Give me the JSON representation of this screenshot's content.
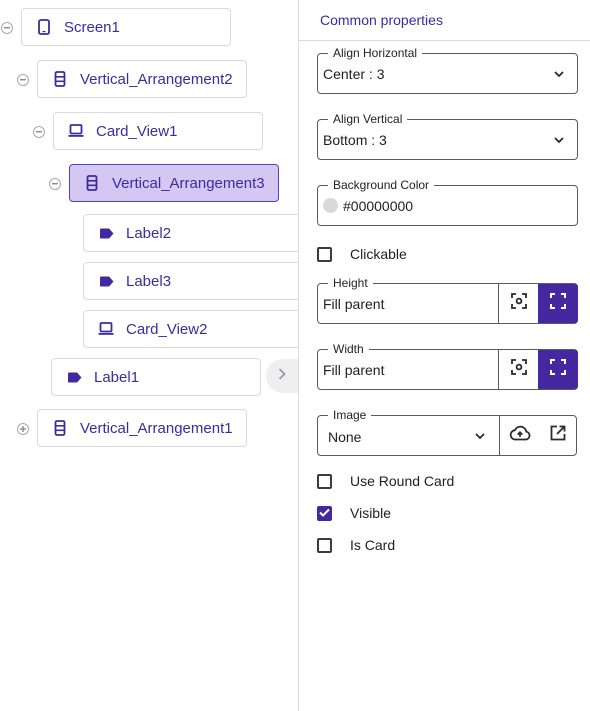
{
  "tree": {
    "nodes": [
      {
        "label": "Screen1",
        "icon": "phone-icon",
        "toggle": "collapse"
      },
      {
        "label": "Vertical_Arrangement2",
        "icon": "vertical-arrangement-icon",
        "toggle": "collapse"
      },
      {
        "label": "Card_View1",
        "icon": "card-view-icon",
        "toggle": "collapse"
      },
      {
        "label": "Vertical_Arrangement3",
        "icon": "vertical-arrangement-icon",
        "toggle": "collapse",
        "selected": true
      },
      {
        "label": "Label2",
        "icon": "label-tag-icon"
      },
      {
        "label": "Label3",
        "icon": "label-tag-icon"
      },
      {
        "label": "Card_View2",
        "icon": "card-view-icon"
      },
      {
        "label": "Label1",
        "icon": "label-tag-icon"
      },
      {
        "label": "Vertical_Arrangement1",
        "icon": "vertical-arrangement-icon",
        "toggle": "expand"
      }
    ],
    "collapse_tab_icon": "chevron-right-icon"
  },
  "properties": {
    "title": "Common properties",
    "align_horizontal": {
      "label": "Align Horizontal",
      "value": "Center : 3"
    },
    "align_vertical": {
      "label": "Align Vertical",
      "value": "Bottom : 3"
    },
    "background_color": {
      "label": "Background Color",
      "value": "#00000000",
      "swatch_color": "#d9d9d9"
    },
    "clickable": {
      "label": "Clickable",
      "checked": false
    },
    "height": {
      "label": "Height",
      "value": "Fill parent"
    },
    "width": {
      "label": "Width",
      "value": "Fill parent"
    },
    "image": {
      "label": "Image",
      "value": "None"
    },
    "use_round_card": {
      "label": "Use Round Card",
      "checked": false
    },
    "visible": {
      "label": "Visible",
      "checked": true
    },
    "is_card": {
      "label": "Is Card",
      "checked": false
    }
  },
  "colors": {
    "accent": "#4527a0",
    "selected_bg": "#d4c8f3",
    "text_accent": "#3f2aa0"
  }
}
